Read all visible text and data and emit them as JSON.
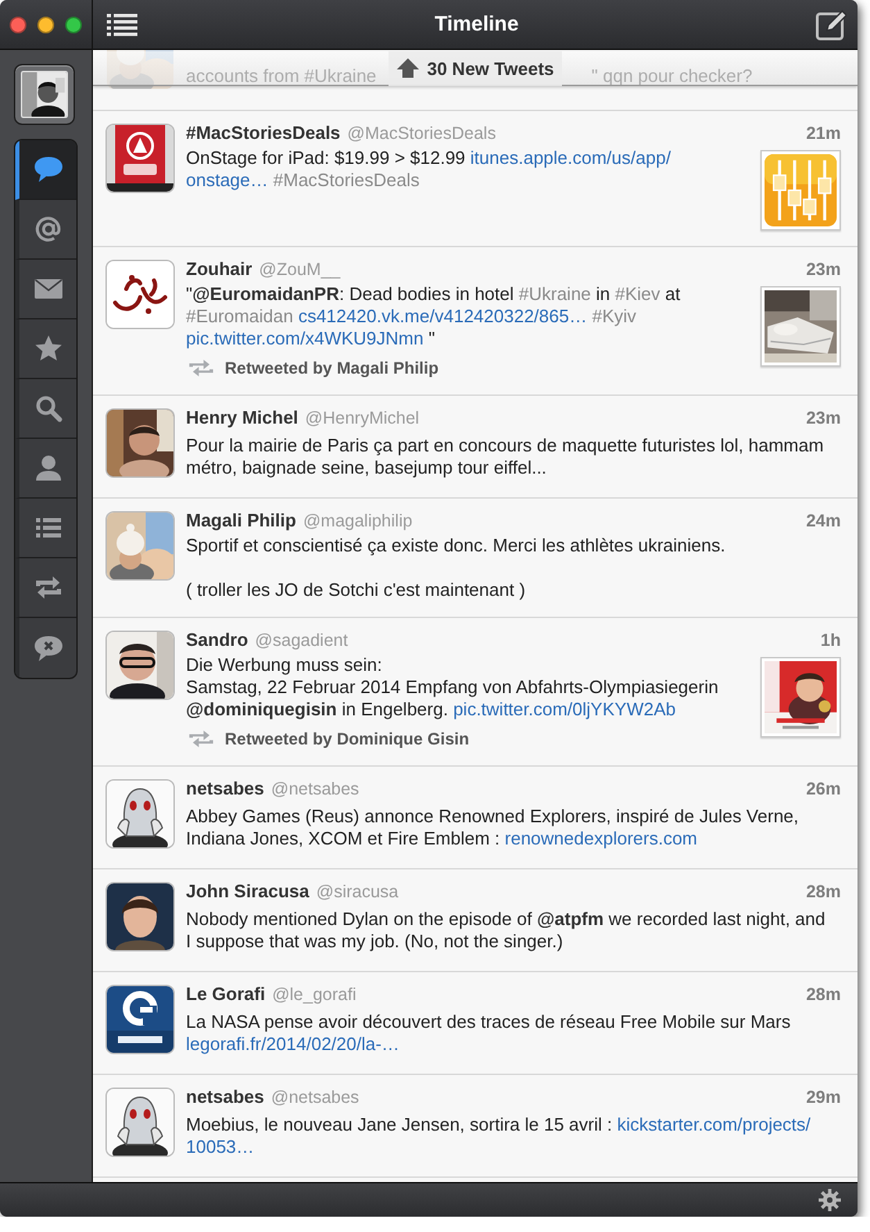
{
  "window": {
    "title": "Timeline"
  },
  "sidebar": {
    "tabs": [
      {
        "kind": "timeline",
        "selected": true
      },
      {
        "kind": "mentions",
        "selected": false
      },
      {
        "kind": "messages",
        "selected": false
      },
      {
        "kind": "favorites",
        "selected": false
      },
      {
        "kind": "search",
        "selected": false
      },
      {
        "kind": "profile",
        "selected": false
      },
      {
        "kind": "lists",
        "selected": false
      },
      {
        "kind": "retweets",
        "selected": false
      },
      {
        "kind": "muted",
        "selected": false
      }
    ]
  },
  "new_tweets_banner": {
    "label": "30 New Tweets"
  },
  "faded_tweet": {
    "visible_parts": [
      "accounts from #Ukraine",
      "\" qqn pour checker?"
    ]
  },
  "tweets": [
    {
      "name": "#MacStoriesDeals",
      "handle": "@MacStoriesDeals",
      "time": "21m",
      "has_thumbnail": true,
      "text": [
        {
          "kind": "plain",
          "text": "OnStage for iPad: $19.99 > $12.99 "
        },
        {
          "kind": "link",
          "text": "itunes.apple.com/us/app/"
        },
        {
          "kind": "link",
          "text": "onstage…",
          "space_after": true
        },
        {
          "kind": "hashtag",
          "text": "#MacStoriesDeals"
        }
      ]
    },
    {
      "name": "Zouhair",
      "handle": "@ZouM__",
      "time": "23m",
      "has_thumbnail": true,
      "retweeted_by": "Retweeted by Magali Philip",
      "text": [
        {
          "kind": "plain",
          "text": "\""
        },
        {
          "kind": "mention",
          "text": "@EuromaidanPR"
        },
        {
          "kind": "plain",
          "text": ": Dead bodies in hotel "
        },
        {
          "kind": "hashtag",
          "text": "#Ukraine"
        },
        {
          "kind": "plain",
          "text": " in "
        },
        {
          "kind": "hashtag",
          "text": "#Kiev"
        },
        {
          "kind": "plain",
          "text": " at "
        },
        {
          "kind": "hashtag",
          "text": "#Euromaidan",
          "space_after": true
        },
        {
          "kind": "link",
          "text": "cs412420.vk.me/v412420322/865…",
          "space_after": true
        },
        {
          "kind": "hashtag",
          "text": "#Kyiv",
          "space_after": true
        },
        {
          "kind": "link",
          "text": "pic.twitter.com/x4WKU9JNmn"
        },
        {
          "kind": "plain",
          "text": " \""
        }
      ]
    },
    {
      "name": "Henry Michel",
      "handle": "@HenryMichel",
      "time": "23m",
      "has_thumbnail": false,
      "text": [
        {
          "kind": "plain",
          "text": "Pour la mairie de Paris ça part en concours de maquette futuristes lol, hammam métro, baignade seine, basejump tour eiffel..."
        }
      ]
    },
    {
      "name": "Magali Philip",
      "handle": "@magaliphilip",
      "time": "24m",
      "has_thumbnail": false,
      "text": [
        {
          "kind": "plain",
          "text": "Sportif et conscientisé ça existe donc. Merci les athlètes ukrainiens.\n\n( troller les JO de Sotchi c'est maintenant )"
        }
      ]
    },
    {
      "name": "Sandro",
      "handle": "@sagadient",
      "time": "1h",
      "has_thumbnail": true,
      "retweeted_by": "Retweeted by Dominique Gisin",
      "text": [
        {
          "kind": "plain",
          "text": "Die Werbung muss sein:\nSamstag, 22 Februar 2014 Empfang von Abfahrts-Olympiasiegerin "
        },
        {
          "kind": "mention",
          "text": "@dominiquegisin"
        },
        {
          "kind": "plain",
          "text": " in Engelberg. "
        },
        {
          "kind": "link",
          "text": "pic.twitter.com/0ljYKYW2Ab"
        }
      ]
    },
    {
      "name": "netsabes",
      "handle": "@netsabes",
      "time": "26m",
      "has_thumbnail": false,
      "text": [
        {
          "kind": "plain",
          "text": "Abbey Games (Reus) annonce Renowned Explorers, inspiré de Jules Verne, Indiana Jones, XCOM et Fire Emblem : "
        },
        {
          "kind": "link",
          "text": "renownedexplorers.com"
        }
      ]
    },
    {
      "name": "John Siracusa",
      "handle": "@siracusa",
      "time": "28m",
      "has_thumbnail": false,
      "text": [
        {
          "kind": "plain",
          "text": "Nobody mentioned Dylan on the episode of "
        },
        {
          "kind": "mention",
          "text": "@atpfm"
        },
        {
          "kind": "plain",
          "text": " we recorded last night, and I suppose that was my job. (No, not the singer.)"
        }
      ]
    },
    {
      "name": "Le Gorafi",
      "handle": "@le_gorafi",
      "time": "28m",
      "has_thumbnail": false,
      "text": [
        {
          "kind": "plain",
          "text": "La NASA pense avoir découvert des traces de réseau Free Mobile sur Mars "
        },
        {
          "kind": "link",
          "text": "legorafi.fr/2014/02/20/la-…"
        }
      ]
    },
    {
      "name": "netsabes",
      "handle": "@netsabes",
      "time": "29m",
      "has_thumbnail": false,
      "text": [
        {
          "kind": "plain",
          "text": "Moebius, le nouveau Jane Jensen, sortira le 15 avril : "
        },
        {
          "kind": "link",
          "text": "kickstarter.com/projects/"
        },
        {
          "kind": "link",
          "text": "10053…"
        }
      ]
    }
  ]
}
